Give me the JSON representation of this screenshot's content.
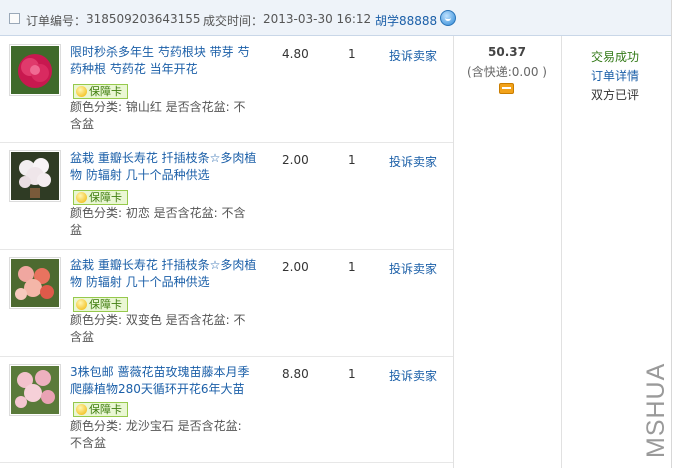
{
  "header": {
    "order_no_label": "订单编号：",
    "order_no": "318509203643155",
    "time_label": "成交时间：",
    "time": "2013-03-30 16:12",
    "seller": "胡学88888"
  },
  "items": [
    {
      "title": "限时秒杀多年生 芍药根块 带芽 芍药种根 芍药花 当年开花",
      "badge": "保障卡",
      "attrs": "颜色分类: 锦山红 是否含花盆: 不含盆",
      "price": "4.80",
      "qty": "1",
      "complain": "投诉卖家"
    },
    {
      "title": "盆栽 重瓣长寿花 扦插枝条☆多肉植物 防辐射 几十个品种供选",
      "badge": "保障卡",
      "attrs": "颜色分类: 初恋 是否含花盆: 不含盆",
      "price": "2.00",
      "qty": "1",
      "complain": "投诉卖家"
    },
    {
      "title": "盆栽 重瓣长寿花 扦插枝条☆多肉植物 防辐射 几十个品种供选",
      "badge": "保障卡",
      "attrs": "颜色分类: 双变色 是否含花盆: 不含盆",
      "price": "2.00",
      "qty": "1",
      "complain": "投诉卖家"
    },
    {
      "title": "3株包邮 蔷薇花苗玫瑰苗藤本月季爬藤植物280天循环开花6年大苗",
      "badge": "保障卡",
      "attrs": "颜色分类: 龙沙宝石 是否含花盆: 不含盆",
      "price": "8.80",
      "qty": "1",
      "complain": "投诉卖家"
    }
  ],
  "summary": {
    "total": "50.37",
    "shipping": "(含快递:0.00 )"
  },
  "status": {
    "state": "交易成功",
    "detail_link": "订单详情",
    "review": "双方已评"
  },
  "watermark": "MSHUA",
  "colors": {
    "link": "#1b5fa8",
    "success": "#337a17",
    "header_bg": "#eef3f9"
  }
}
